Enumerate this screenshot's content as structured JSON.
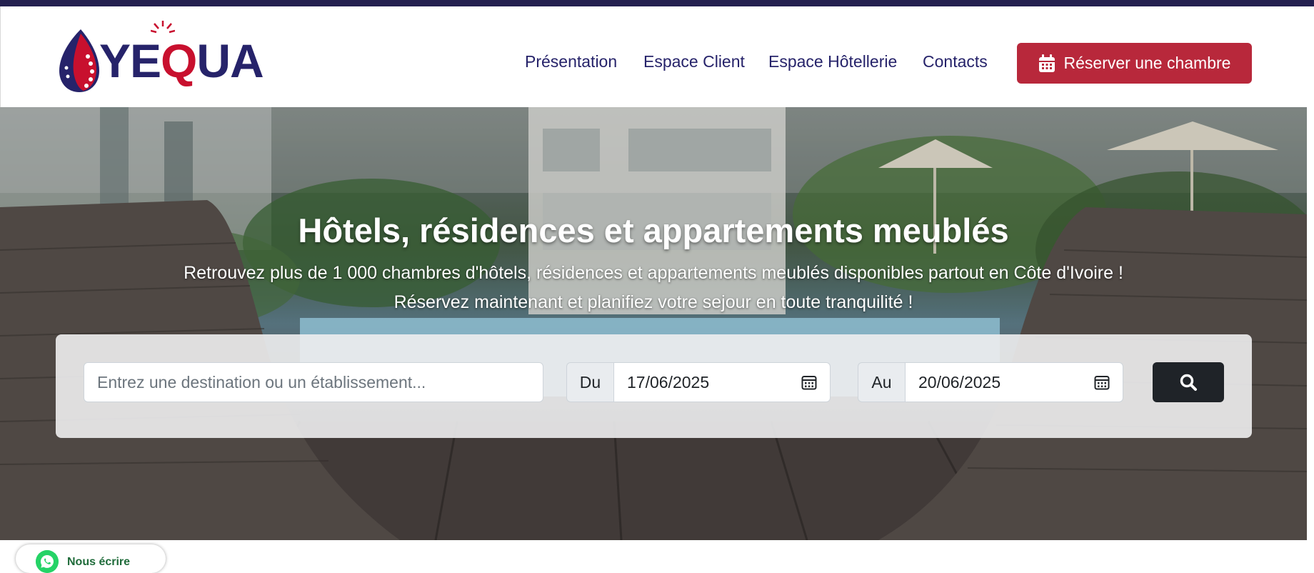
{
  "brand": {
    "logo_text_left": "YE",
    "logo_text_q": "Q",
    "logo_text_right": "UA",
    "colors": {
      "navy": "#26236a",
      "red": "#c8102e",
      "button_red": "#b8283b",
      "search_dark": "#1f2328",
      "whatsapp_green": "#25d366"
    }
  },
  "nav": {
    "links": [
      {
        "label": "Présentation"
      },
      {
        "label": "Espace Client"
      },
      {
        "label": "Espace Hôtellerie"
      },
      {
        "label": "Contacts"
      }
    ],
    "cta_label": "Réserver une chambre",
    "cta_icon": "calendar-icon"
  },
  "hero": {
    "title": "Hôtels, résidences et appartements meublés",
    "subtitle_line1": "Retrouvez plus de 1 000 chambres d'hôtels, résidences et appartements meublés disponibles partout en Côte d'Ivoire !",
    "subtitle_line2": "Réservez maintenant et planifiez votre sejour en toute tranquilité !"
  },
  "search": {
    "destination_placeholder": "Entrez une destination ou un établissement...",
    "from_label": "Du",
    "from_value": "17/06/2025",
    "to_label": "Au",
    "to_value": "20/06/2025",
    "date_icon": "calendar-icon",
    "submit_icon": "search-icon"
  },
  "whatsapp": {
    "label": "Nous écrire",
    "icon": "whatsapp-icon"
  }
}
